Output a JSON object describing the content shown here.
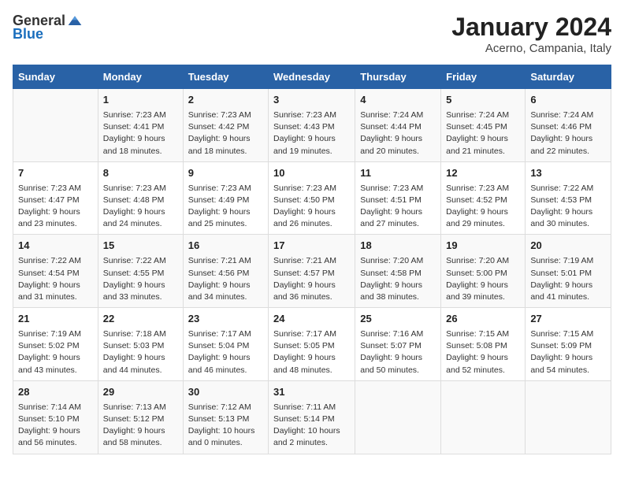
{
  "header": {
    "logo_general": "General",
    "logo_blue": "Blue",
    "title": "January 2024",
    "location": "Acerno, Campania, Italy"
  },
  "days_of_week": [
    "Sunday",
    "Monday",
    "Tuesday",
    "Wednesday",
    "Thursday",
    "Friday",
    "Saturday"
  ],
  "weeks": [
    [
      {
        "day": "",
        "sunrise": "",
        "sunset": "",
        "daylight": ""
      },
      {
        "day": "1",
        "sunrise": "Sunrise: 7:23 AM",
        "sunset": "Sunset: 4:41 PM",
        "daylight": "Daylight: 9 hours and 18 minutes."
      },
      {
        "day": "2",
        "sunrise": "Sunrise: 7:23 AM",
        "sunset": "Sunset: 4:42 PM",
        "daylight": "Daylight: 9 hours and 18 minutes."
      },
      {
        "day": "3",
        "sunrise": "Sunrise: 7:23 AM",
        "sunset": "Sunset: 4:43 PM",
        "daylight": "Daylight: 9 hours and 19 minutes."
      },
      {
        "day": "4",
        "sunrise": "Sunrise: 7:24 AM",
        "sunset": "Sunset: 4:44 PM",
        "daylight": "Daylight: 9 hours and 20 minutes."
      },
      {
        "day": "5",
        "sunrise": "Sunrise: 7:24 AM",
        "sunset": "Sunset: 4:45 PM",
        "daylight": "Daylight: 9 hours and 21 minutes."
      },
      {
        "day": "6",
        "sunrise": "Sunrise: 7:24 AM",
        "sunset": "Sunset: 4:46 PM",
        "daylight": "Daylight: 9 hours and 22 minutes."
      }
    ],
    [
      {
        "day": "7",
        "sunrise": "Sunrise: 7:23 AM",
        "sunset": "Sunset: 4:47 PM",
        "daylight": "Daylight: 9 hours and 23 minutes."
      },
      {
        "day": "8",
        "sunrise": "Sunrise: 7:23 AM",
        "sunset": "Sunset: 4:48 PM",
        "daylight": "Daylight: 9 hours and 24 minutes."
      },
      {
        "day": "9",
        "sunrise": "Sunrise: 7:23 AM",
        "sunset": "Sunset: 4:49 PM",
        "daylight": "Daylight: 9 hours and 25 minutes."
      },
      {
        "day": "10",
        "sunrise": "Sunrise: 7:23 AM",
        "sunset": "Sunset: 4:50 PM",
        "daylight": "Daylight: 9 hours and 26 minutes."
      },
      {
        "day": "11",
        "sunrise": "Sunrise: 7:23 AM",
        "sunset": "Sunset: 4:51 PM",
        "daylight": "Daylight: 9 hours and 27 minutes."
      },
      {
        "day": "12",
        "sunrise": "Sunrise: 7:23 AM",
        "sunset": "Sunset: 4:52 PM",
        "daylight": "Daylight: 9 hours and 29 minutes."
      },
      {
        "day": "13",
        "sunrise": "Sunrise: 7:22 AM",
        "sunset": "Sunset: 4:53 PM",
        "daylight": "Daylight: 9 hours and 30 minutes."
      }
    ],
    [
      {
        "day": "14",
        "sunrise": "Sunrise: 7:22 AM",
        "sunset": "Sunset: 4:54 PM",
        "daylight": "Daylight: 9 hours and 31 minutes."
      },
      {
        "day": "15",
        "sunrise": "Sunrise: 7:22 AM",
        "sunset": "Sunset: 4:55 PM",
        "daylight": "Daylight: 9 hours and 33 minutes."
      },
      {
        "day": "16",
        "sunrise": "Sunrise: 7:21 AM",
        "sunset": "Sunset: 4:56 PM",
        "daylight": "Daylight: 9 hours and 34 minutes."
      },
      {
        "day": "17",
        "sunrise": "Sunrise: 7:21 AM",
        "sunset": "Sunset: 4:57 PM",
        "daylight": "Daylight: 9 hours and 36 minutes."
      },
      {
        "day": "18",
        "sunrise": "Sunrise: 7:20 AM",
        "sunset": "Sunset: 4:58 PM",
        "daylight": "Daylight: 9 hours and 38 minutes."
      },
      {
        "day": "19",
        "sunrise": "Sunrise: 7:20 AM",
        "sunset": "Sunset: 5:00 PM",
        "daylight": "Daylight: 9 hours and 39 minutes."
      },
      {
        "day": "20",
        "sunrise": "Sunrise: 7:19 AM",
        "sunset": "Sunset: 5:01 PM",
        "daylight": "Daylight: 9 hours and 41 minutes."
      }
    ],
    [
      {
        "day": "21",
        "sunrise": "Sunrise: 7:19 AM",
        "sunset": "Sunset: 5:02 PM",
        "daylight": "Daylight: 9 hours and 43 minutes."
      },
      {
        "day": "22",
        "sunrise": "Sunrise: 7:18 AM",
        "sunset": "Sunset: 5:03 PM",
        "daylight": "Daylight: 9 hours and 44 minutes."
      },
      {
        "day": "23",
        "sunrise": "Sunrise: 7:17 AM",
        "sunset": "Sunset: 5:04 PM",
        "daylight": "Daylight: 9 hours and 46 minutes."
      },
      {
        "day": "24",
        "sunrise": "Sunrise: 7:17 AM",
        "sunset": "Sunset: 5:05 PM",
        "daylight": "Daylight: 9 hours and 48 minutes."
      },
      {
        "day": "25",
        "sunrise": "Sunrise: 7:16 AM",
        "sunset": "Sunset: 5:07 PM",
        "daylight": "Daylight: 9 hours and 50 minutes."
      },
      {
        "day": "26",
        "sunrise": "Sunrise: 7:15 AM",
        "sunset": "Sunset: 5:08 PM",
        "daylight": "Daylight: 9 hours and 52 minutes."
      },
      {
        "day": "27",
        "sunrise": "Sunrise: 7:15 AM",
        "sunset": "Sunset: 5:09 PM",
        "daylight": "Daylight: 9 hours and 54 minutes."
      }
    ],
    [
      {
        "day": "28",
        "sunrise": "Sunrise: 7:14 AM",
        "sunset": "Sunset: 5:10 PM",
        "daylight": "Daylight: 9 hours and 56 minutes."
      },
      {
        "day": "29",
        "sunrise": "Sunrise: 7:13 AM",
        "sunset": "Sunset: 5:12 PM",
        "daylight": "Daylight: 9 hours and 58 minutes."
      },
      {
        "day": "30",
        "sunrise": "Sunrise: 7:12 AM",
        "sunset": "Sunset: 5:13 PM",
        "daylight": "Daylight: 10 hours and 0 minutes."
      },
      {
        "day": "31",
        "sunrise": "Sunrise: 7:11 AM",
        "sunset": "Sunset: 5:14 PM",
        "daylight": "Daylight: 10 hours and 2 minutes."
      },
      {
        "day": "",
        "sunrise": "",
        "sunset": "",
        "daylight": ""
      },
      {
        "day": "",
        "sunrise": "",
        "sunset": "",
        "daylight": ""
      },
      {
        "day": "",
        "sunrise": "",
        "sunset": "",
        "daylight": ""
      }
    ]
  ]
}
